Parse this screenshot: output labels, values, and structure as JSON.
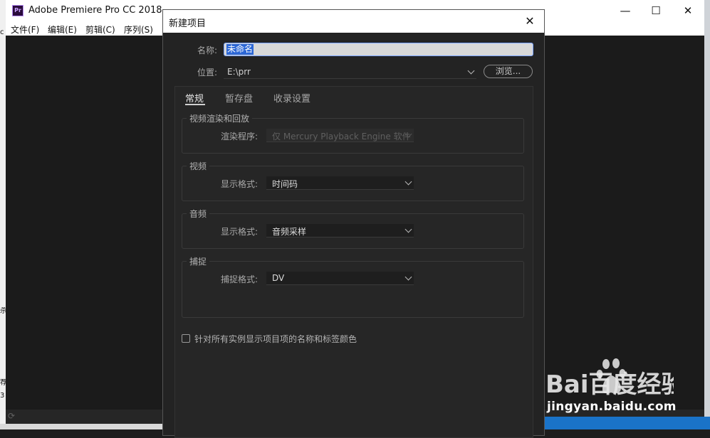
{
  "app": {
    "logo_text": "Pr",
    "title": "Adobe Premiere Pro CC 2018",
    "menu": [
      "文件(F)",
      "编辑(E)",
      "剪辑(C)",
      "序列(S)"
    ],
    "window_controls": [
      "—",
      "☐",
      "✕"
    ]
  },
  "desktop": {
    "edge_text": [
      "c",
      "杀",
      "荐",
      "3"
    ]
  },
  "dialog": {
    "title": "新建项目",
    "close_glyph": "✕",
    "name_label": "名称:",
    "name_value": "未命名",
    "location_label": "位置:",
    "location_value": "E:\\prr",
    "browse_label": "浏览...",
    "tabs": [
      "常规",
      "暂存盘",
      "收录设置"
    ],
    "active_tab": "常规",
    "groups": {
      "render": {
        "title": "视频渲染和回放",
        "row_label": "渲染程序:",
        "value": "仅 Mercury Playback Engine 软件",
        "disabled": true
      },
      "video": {
        "title": "视频",
        "row_label": "显示格式:",
        "value": "时间码"
      },
      "audio": {
        "title": "音频",
        "row_label": "显示格式:",
        "value": "音频采样"
      },
      "capture": {
        "title": "捕捉",
        "row_label": "捕捉格式:",
        "value": "DV"
      }
    },
    "checkbox_label": "针对所有实例显示项目项的名称和标签颜色",
    "checkbox_checked": false
  },
  "watermark": {
    "brand": "Bai百度经验",
    "url": "jingyan.baidu.com"
  },
  "colors": {
    "dialog_bg": "#232323",
    "selection": "#2c67d6",
    "app_bg": "#1b1b1b"
  }
}
